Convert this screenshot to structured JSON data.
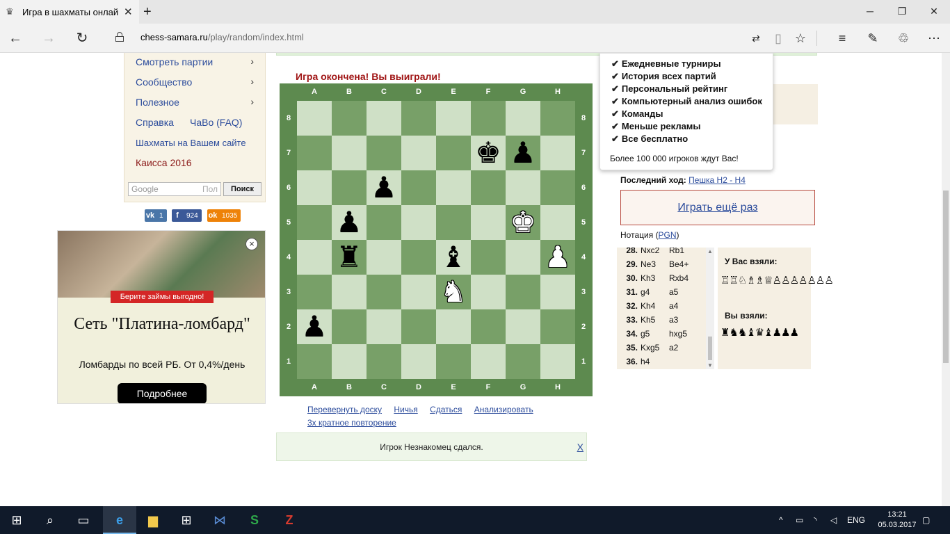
{
  "browser": {
    "tab_title": "Игра в шахматы онлай",
    "tab_close": "✕",
    "new_tab": "+",
    "url_host": "chess-samara.ru",
    "url_path": "/play/random/index.html",
    "icons": [
      "back-icon",
      "forward-icon",
      "refresh-icon",
      "lock-icon",
      "reading-view-icon",
      "book-icon",
      "favorite-star-icon",
      "hub-icon",
      "web-note-icon",
      "share-icon",
      "more-icon"
    ]
  },
  "sidebar": {
    "items": [
      {
        "label": "Смотреть партии",
        "chevron": "›"
      },
      {
        "label": "Сообщество",
        "chevron": "›"
      },
      {
        "label": "Полезное",
        "chevron": "›"
      },
      {
        "label": "Справка"
      },
      {
        "label": "ЧаВо (FAQ)"
      },
      {
        "label": "Шахматы на Вашем сайте"
      },
      {
        "label": "Каисса 2016"
      }
    ],
    "search": {
      "placeholder": "Google",
      "suffix": "Пол",
      "button": "Поиск"
    }
  },
  "social": [
    {
      "network": "vk",
      "icon": "vk",
      "count": "1",
      "color": "#4a76a8"
    },
    {
      "network": "facebook",
      "icon": "f",
      "count": "924",
      "color": "#3b5998"
    },
    {
      "network": "odnoklassniki",
      "icon": "ok",
      "count": "1035",
      "color": "#ee8208"
    }
  ],
  "ad": {
    "ribbon": "Берите займы выгодно!",
    "headline": "Сеть \"Платина-ломбард\"",
    "sub": "Ломбарды по всей РБ. От 0,4%/день",
    "button": "Подробнее",
    "close": "×"
  },
  "game": {
    "status_title": "Игра окончена! Вы выиграли!",
    "files": [
      "A",
      "B",
      "C",
      "D",
      "E",
      "F",
      "G",
      "H"
    ],
    "ranks": [
      "8",
      "7",
      "6",
      "5",
      "4",
      "3",
      "2",
      "1"
    ],
    "pieces": [
      {
        "square": "f7",
        "glyph": "♚",
        "color": "black",
        "name": "black-king"
      },
      {
        "square": "g7",
        "glyph": "♟",
        "color": "black",
        "name": "black-pawn"
      },
      {
        "square": "c6",
        "glyph": "♟",
        "color": "black",
        "name": "black-pawn"
      },
      {
        "square": "b5",
        "glyph": "♟",
        "color": "black",
        "name": "black-pawn"
      },
      {
        "square": "g5",
        "glyph": "♚",
        "color": "white",
        "name": "white-king"
      },
      {
        "square": "b4",
        "glyph": "♜",
        "color": "black",
        "name": "black-rook"
      },
      {
        "square": "e4",
        "glyph": "♝",
        "color": "black",
        "name": "black-bishop"
      },
      {
        "square": "h4",
        "glyph": "♟",
        "color": "white",
        "name": "white-pawn"
      },
      {
        "square": "e3",
        "glyph": "♞",
        "color": "white",
        "name": "white-knight"
      },
      {
        "square": "a2",
        "glyph": "♟",
        "color": "black",
        "name": "black-pawn"
      }
    ],
    "links": [
      "Перевернуть доску",
      "Ничья",
      "Сдаться",
      "Анализировать"
    ],
    "repetition_link": "3х кратное повторение",
    "status_message": "Игрок Незнакомец сдался.",
    "status_close": "X"
  },
  "promo": {
    "items": [
      "Ежедневные турниры",
      "История всех партий",
      "Персональный рейтинг",
      "Компьютерный анализ ошибок",
      "Команды",
      "Меньше рекламы",
      "Все бесплатно"
    ],
    "check": "✔",
    "footer": "Более 100 000 игроков ждут Вас!"
  },
  "sidepanel": {
    "last_move_label": "Последний ход:",
    "last_move_link": "Пешка H2 - H4",
    "play_again": "Играть ещё раз",
    "notation_label": "Нотация (",
    "notation_link": "PGN",
    "notation_close": ")",
    "moves": [
      {
        "num": "28.",
        "white": "Nxc2",
        "black": "Rb1"
      },
      {
        "num": "29.",
        "white": "Ne3",
        "black": "Be4+"
      },
      {
        "num": "30.",
        "white": "Kh3",
        "black": "Rxb4"
      },
      {
        "num": "31.",
        "white": "g4",
        "black": "a5"
      },
      {
        "num": "32.",
        "white": "Kh4",
        "black": "a4"
      },
      {
        "num": "33.",
        "white": "Kh5",
        "black": "a3"
      },
      {
        "num": "34.",
        "white": "g5",
        "black": "hxg5"
      },
      {
        "num": "35.",
        "white": "Kxg5",
        "black": "a2"
      },
      {
        "num": "36.",
        "white": "h4",
        "black": ""
      }
    ],
    "taken_from_you_label": "У Вас взяли:",
    "taken_from_you": "♖♖♘♗♗♕♙♙♙♙♙♙♙",
    "you_took_label": "Вы взяли:",
    "you_took": "♜♞♞♝♛♝♟♟♟"
  },
  "taskbar": {
    "lang": "ENG",
    "time": "13:21",
    "date": "05.03.2017"
  }
}
